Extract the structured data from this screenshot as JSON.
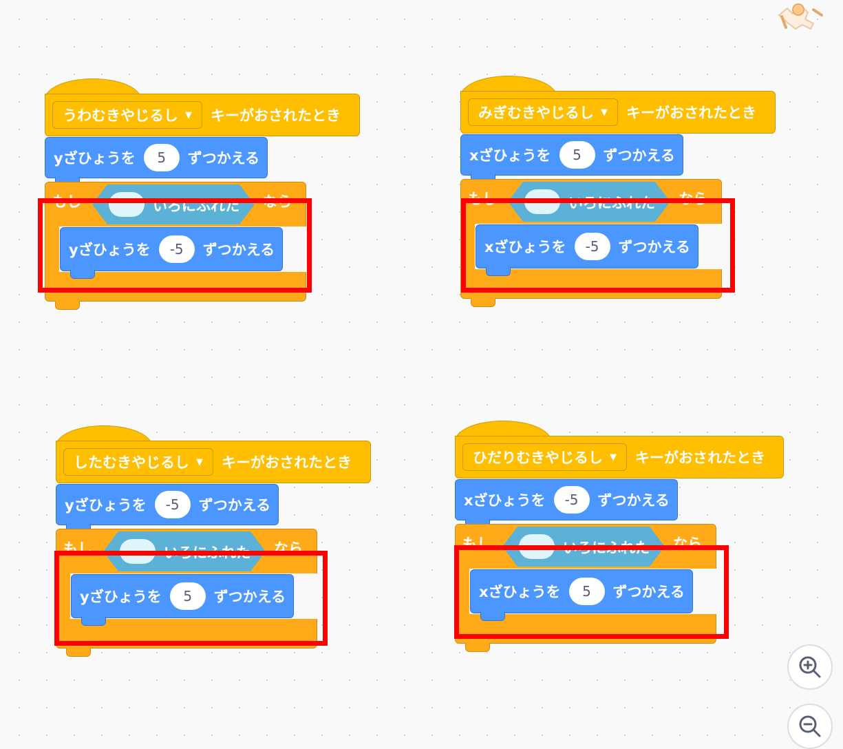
{
  "scripts": [
    {
      "key_option": "うわむきやじるし",
      "hat_suffix": "キーがおされたとき",
      "move_label": "yざひょうを",
      "move_value": "5",
      "move_suffix": "ずつかえる",
      "if_prefix": "もし",
      "if_condition": "いろにふれた",
      "if_suffix": "なら",
      "inner_label": "yざひょうを",
      "inner_value": "-5",
      "inner_suffix": "ずつかえる"
    },
    {
      "key_option": "みぎむきやじるし",
      "hat_suffix": "キーがおされたとき",
      "move_label": "xざひょうを",
      "move_value": "5",
      "move_suffix": "ずつかえる",
      "if_prefix": "もし",
      "if_condition": "いろにふれた",
      "if_suffix": "なら",
      "inner_label": "xざひょうを",
      "inner_value": "-5",
      "inner_suffix": "ずつかえる"
    },
    {
      "key_option": "したむきやじるし",
      "hat_suffix": "キーがおされたとき",
      "move_label": "yざひょうを",
      "move_value": "-5",
      "move_suffix": "ずつかえる",
      "if_prefix": "もし",
      "if_condition": "いろにふれた",
      "if_suffix": "なら",
      "inner_label": "yざひょうを",
      "inner_value": "5",
      "inner_suffix": "ずつかえる"
    },
    {
      "key_option": "ひだりむきやじるし",
      "hat_suffix": "キーがおされたとき",
      "move_label": "xざひょうを",
      "move_value": "-5",
      "move_suffix": "ずつかえる",
      "if_prefix": "もし",
      "if_condition": "いろにふれた",
      "if_suffix": "なら",
      "inner_label": "xざひょうを",
      "inner_value": "5",
      "inner_suffix": "ずつかえる"
    }
  ],
  "colors": {
    "events": "#ffbf00",
    "motion": "#4c97ff",
    "control": "#ffab19",
    "sensing": "#5cb1d6",
    "highlight": "#ff0000",
    "touch_color": "#dff4fb"
  },
  "icons": {
    "sprite": "cat-sprite-icon",
    "zoom_in": "zoom-in-icon",
    "zoom_out": "zoom-out-icon"
  }
}
